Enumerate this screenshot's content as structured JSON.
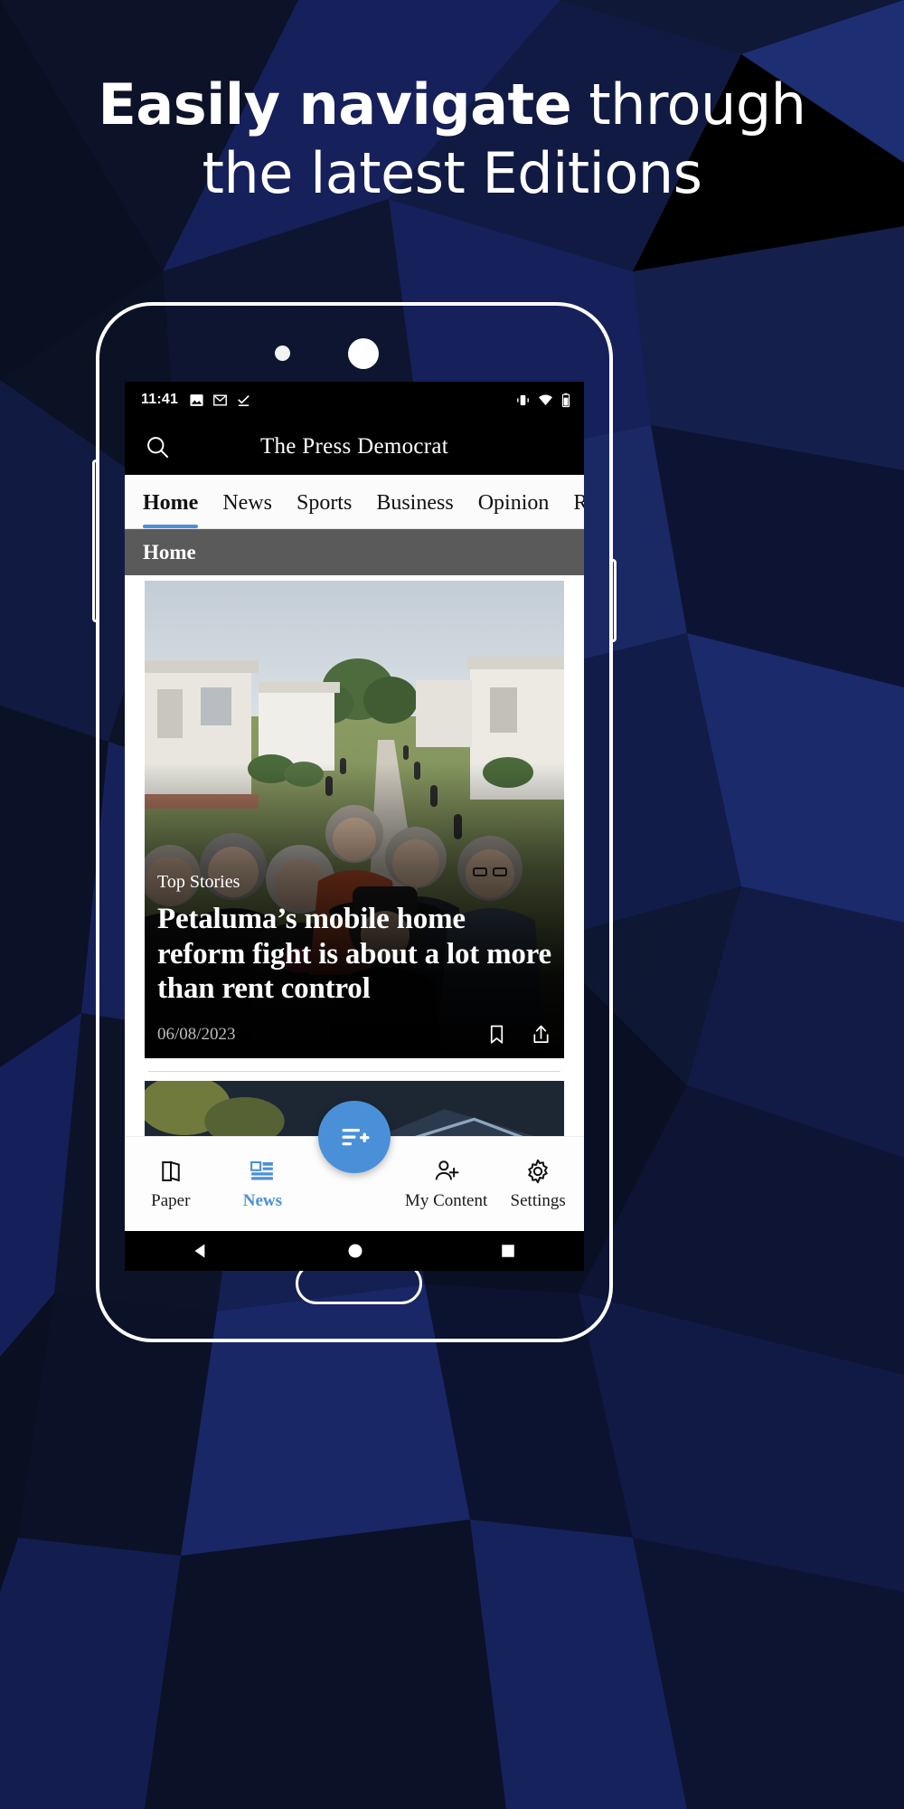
{
  "promo": {
    "headline_line1_strong": "Easily navigate",
    "headline_line1_normal": " through",
    "headline_line2": "the latest Editions"
  },
  "colors": {
    "background_dark": "#0b1226",
    "background_blue": "#1b2f6b",
    "accent_blue": "#4a90d9",
    "section_gray": "#5a5a5a",
    "card_black": "#000000"
  },
  "device": {
    "statusbar": {
      "time": "11:41",
      "left_icons": [
        "image-icon",
        "gmail-icon",
        "check-download-icon"
      ],
      "right_icons": [
        "vibrate-icon",
        "wifi-icon",
        "battery-icon"
      ]
    },
    "masthead": {
      "search_icon": "search-icon",
      "logo": "The Press Democrat"
    },
    "tabs": [
      {
        "label": "Home",
        "active": true
      },
      {
        "label": "News",
        "active": false
      },
      {
        "label": "Sports",
        "active": false
      },
      {
        "label": "Business",
        "active": false
      },
      {
        "label": "Opinion",
        "active": false
      },
      {
        "label": "Rea",
        "active": false
      }
    ],
    "section_header": "Home",
    "feature_article": {
      "kicker": "Top Stories",
      "title": "Petaluma’s mobile home reform fight is about a lot more than rent control",
      "date": "06/08/2023",
      "actions": [
        "bookmark-icon",
        "share-icon"
      ]
    },
    "bottom_nav": [
      {
        "label": "Paper",
        "icon": "paper-icon",
        "active": false
      },
      {
        "label": "News",
        "icon": "news-icon",
        "active": true
      },
      {
        "label": "",
        "icon": "fab-add-feed-icon",
        "active": false
      },
      {
        "label": "My Content",
        "icon": "add-person-icon",
        "active": false
      },
      {
        "label": "Settings",
        "icon": "gear-icon",
        "active": false
      }
    ],
    "android_nav": [
      "back-icon",
      "home-icon",
      "recents-icon"
    ]
  }
}
